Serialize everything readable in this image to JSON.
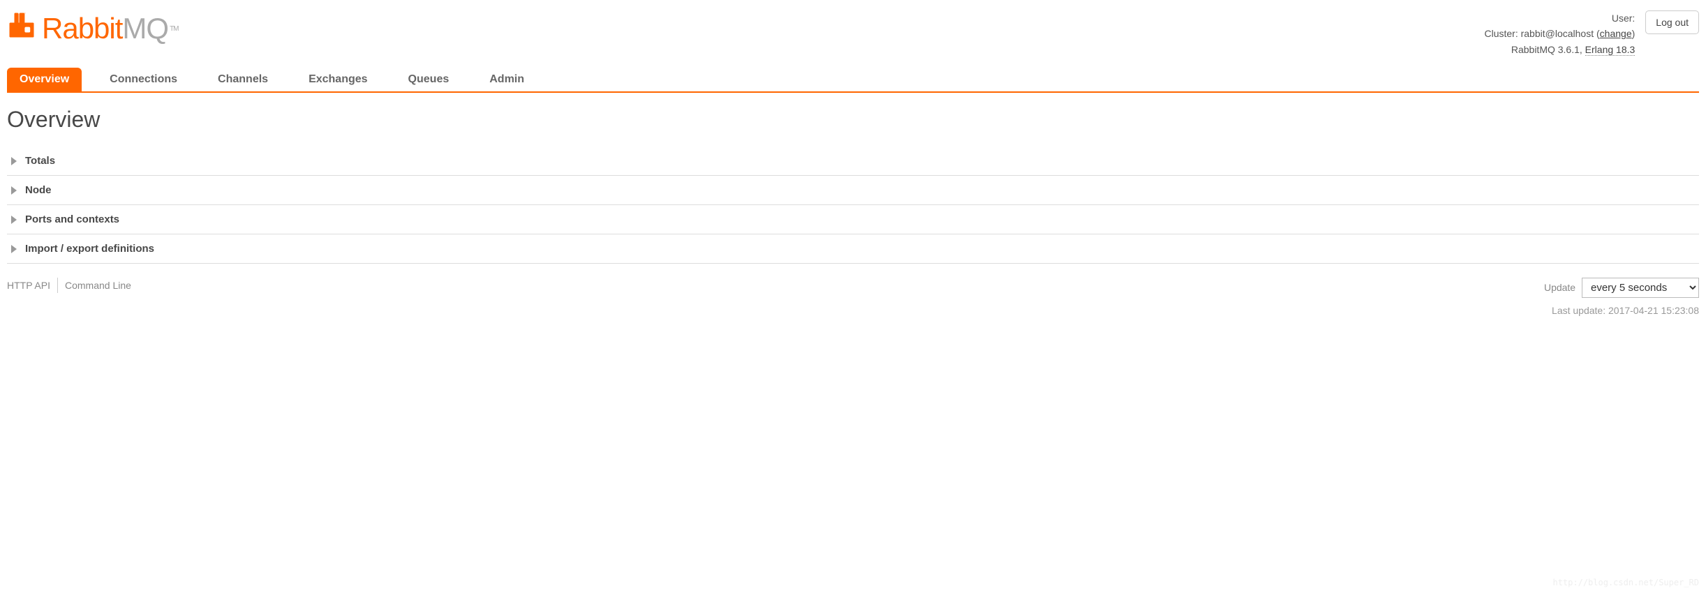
{
  "brand": {
    "name_part1": "Rabbit",
    "name_part2": "MQ",
    "tm": "TM"
  },
  "top": {
    "user_label": "User:",
    "user_value": "",
    "cluster_label": "Cluster:",
    "cluster_value": "rabbit@localhost",
    "change_link": "change",
    "version_product": "RabbitMQ 3.6.1,",
    "version_erlang": "Erlang 18.3",
    "logout": "Log out"
  },
  "tabs": [
    {
      "label": "Overview",
      "active": true
    },
    {
      "label": "Connections",
      "active": false
    },
    {
      "label": "Channels",
      "active": false
    },
    {
      "label": "Exchanges",
      "active": false
    },
    {
      "label": "Queues",
      "active": false
    },
    {
      "label": "Admin",
      "active": false
    }
  ],
  "page_title": "Overview",
  "sections": [
    {
      "title": "Totals"
    },
    {
      "title": "Node"
    },
    {
      "title": "Ports and contexts"
    },
    {
      "title": "Import / export definitions"
    }
  ],
  "footer": {
    "http_api": "HTTP API",
    "cmd_line": "Command Line",
    "update_label": "Update",
    "update_option": "every 5 seconds",
    "last_update_label": "Last update:",
    "last_update_value": "2017-04-21 15:23:08"
  },
  "watermark": "http://blog.csdn.net/Super_RD"
}
